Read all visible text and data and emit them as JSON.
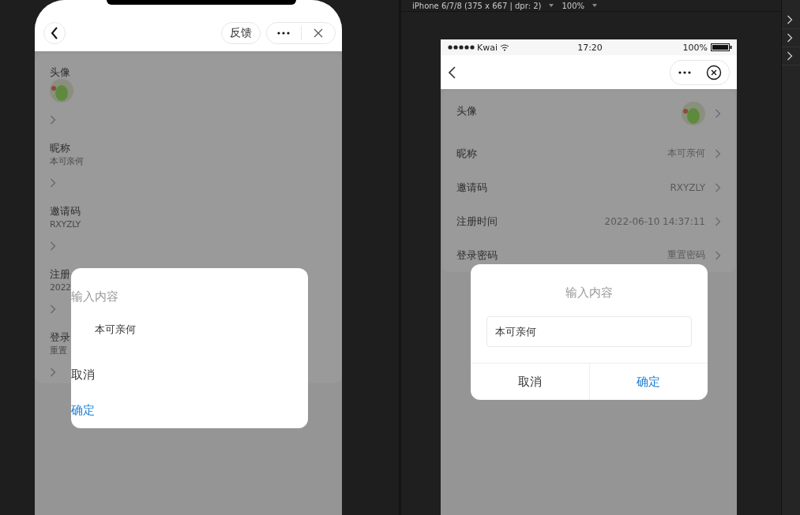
{
  "devtools": {
    "device": "iPhone 6/7/8 (375 x 667 | dpr: 2)",
    "zoom": "100%"
  },
  "left_phone": {
    "nav": {
      "feedback": "反馈"
    },
    "items": [
      {
        "kind": "avatar",
        "label": "头像"
      },
      {
        "kind": "text",
        "label": "昵称",
        "value": "本可亲何"
      },
      {
        "kind": "text",
        "label": "邀请码",
        "value": "RXYZLY"
      },
      {
        "kind": "text",
        "label": "注册",
        "value": "2022"
      },
      {
        "kind": "text",
        "label": "登录",
        "value": "重置"
      }
    ],
    "dialog": {
      "title": "输入内容",
      "input_value": "本可亲何",
      "cancel": "取消",
      "confirm": "确定"
    }
  },
  "right_phone": {
    "status_bar": {
      "carrier": "Kwai",
      "time": "17:20",
      "battery": "100%"
    },
    "items": [
      {
        "kind": "avatar",
        "label": "头像"
      },
      {
        "kind": "text",
        "label": "昵称",
        "value": "本可亲何"
      },
      {
        "kind": "text",
        "label": "邀请码",
        "value": "RXYZLY"
      },
      {
        "kind": "text",
        "label": "注册时间",
        "value": "2022-06-10 14:37:11"
      },
      {
        "kind": "text",
        "label": "登录密码",
        "value": "重置密码"
      }
    ],
    "dialog": {
      "title": "输入内容",
      "input_value": "本可亲何",
      "cancel": "取消",
      "confirm": "确定"
    }
  }
}
